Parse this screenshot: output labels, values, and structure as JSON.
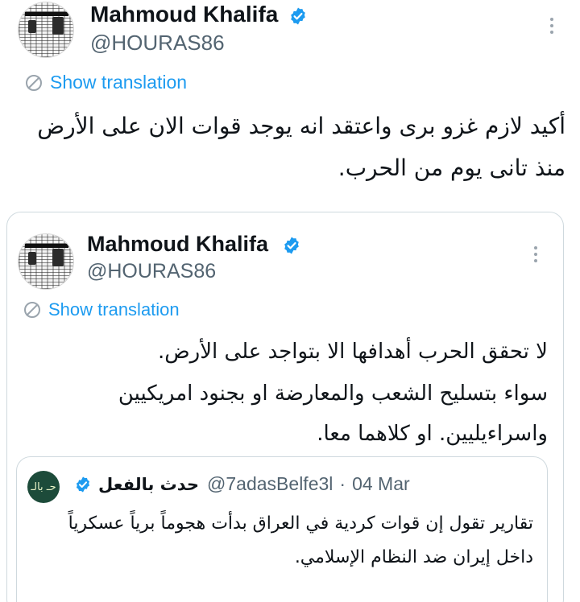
{
  "main_tweet": {
    "author_name": "Mahmoud Khalifa",
    "author_handle": "@HOURAS86",
    "show_translation": "Show translation",
    "text_line1": "أكيد لازم غزو برى واعتقد انه يوجد قوات الان على الأرض",
    "text_line2": "منذ تانى يوم من الحرب."
  },
  "quoted_tweet": {
    "author_name": "Mahmoud Khalifa",
    "author_handle": "@HOURAS86",
    "show_translation": "Show translation",
    "text_line1": "لا تحقق الحرب أهدافها الا بتواجد على الأرض.",
    "text_line2": "سواء بتسليح الشعب والمعارضة او بجنود امريكيين",
    "text_line3": "واسراءيليين. او كلاهما معا."
  },
  "nested_quote": {
    "author_name": "حدث بالفعل",
    "author_handle": "@7adasBelfe3l",
    "separator": "·",
    "date": "04 Mar",
    "avatar_text": "حـ بالـ",
    "text_line1": "تقارير تقول إن قوات كردية في العراق بدأت هجوماً برياً عسكرياً",
    "text_line2": "داخل إيران ضد النظام الإسلامي."
  },
  "colors": {
    "link": "#1d9bf0",
    "verified": "#1d9bf0",
    "secondary_text": "#536471",
    "border": "#cfd9de"
  },
  "icons": [
    "verified-badge-icon",
    "more-options-icon",
    "translate-icon"
  ]
}
